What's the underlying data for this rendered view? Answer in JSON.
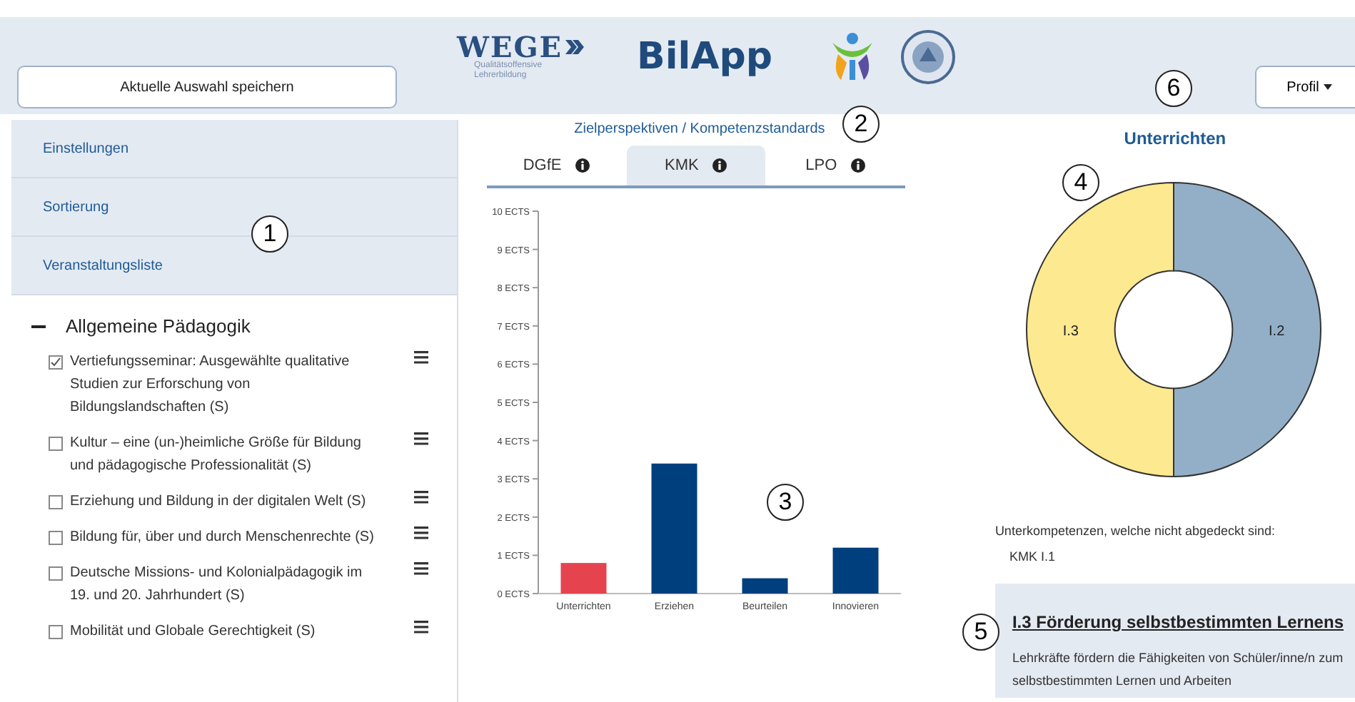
{
  "header": {
    "save_button": "Aktuelle Auswahl speichern",
    "logo_wege": {
      "word": "WEGE",
      "subtitle_1": "Qualitätsoffensive",
      "subtitle_2": "Lehrerbildung"
    },
    "app_title": "BilApp",
    "profile_button": "Profil"
  },
  "sidebar": {
    "panels": [
      "Einstellungen",
      "Sortierung",
      "Veranstaltungsliste"
    ],
    "group": {
      "title": "Allgemeine Pädagogik",
      "expanded": true,
      "courses": [
        {
          "title": "Vertiefungsseminar: Ausgewählte qualitative Studien zur Erforschung von Bildungslandschaften (S)",
          "checked": true
        },
        {
          "title": "Kultur – eine (un-)heimliche Größe für Bildung und pädagogische Professionalität (S)",
          "checked": false
        },
        {
          "title": "Erziehung und Bildung in der digitalen Welt (S)",
          "checked": false
        },
        {
          "title": "Bildung für, über und durch Menschenrechte (S)",
          "checked": false
        },
        {
          "title": "Deutsche Missions- und Kolonialpädagogik im 19. und 20. Jahrhundert (S)",
          "checked": false
        },
        {
          "title": "Mobilität und Globale Gerechtigkeit (S)",
          "checked": false
        }
      ]
    }
  },
  "center": {
    "heading": "Zielperspektiven / Kompetenzstandards",
    "tabs": [
      {
        "label": "DGfE",
        "selected": false
      },
      {
        "label": "KMK",
        "selected": true
      },
      {
        "label": "LPO",
        "selected": false
      }
    ],
    "bars": [
      {
        "color": "#e5444f"
      },
      {
        "color": "#003f7d"
      },
      {
        "color": "#003f7d"
      },
      {
        "color": "#003f7d"
      }
    ],
    "chart_data": {
      "type": "bar",
      "categories": [
        "Unterrichten",
        "Erziehen",
        "Beurteilen",
        "Innovieren"
      ],
      "values": [
        0.8,
        3.4,
        0.4,
        1.2
      ],
      "ylim": [
        0,
        10
      ],
      "yticks": [
        {
          "value": 0,
          "label": "0 ECTS"
        },
        {
          "value": 1,
          "label": "1 ECTS"
        },
        {
          "value": 2,
          "label": "2 ECTS"
        },
        {
          "value": 3,
          "label": "3 ECTS"
        },
        {
          "value": 4,
          "label": "4 ECTS"
        },
        {
          "value": 5,
          "label": "5 ECTS"
        },
        {
          "value": 6,
          "label": "6 ECTS"
        },
        {
          "value": 7,
          "label": "7 ECTS"
        },
        {
          "value": 8,
          "label": "8 ECTS"
        },
        {
          "value": 9,
          "label": "9 ECTS"
        },
        {
          "value": 10,
          "label": "10 ECTS"
        }
      ]
    }
  },
  "right": {
    "title": "Unterrichten",
    "slices": [
      {
        "color": "#fde98f"
      },
      {
        "color": "#93afc8"
      }
    ],
    "chart_data": {
      "type": "donut",
      "categories": [
        "I.3",
        "I.2"
      ],
      "values": [
        50,
        50
      ]
    },
    "missing_label": "Unterkompetenzen, welche nicht abgedeckt sind:",
    "missing": [
      "KMK I.1"
    ],
    "info": {
      "title": "I.3 Förderung selbstbestimmten Lernens",
      "text": "Lehrkräfte fördern die Fähigkeiten von Schüler/inne/n zum selbstbestimmten Lernen und Arbeiten"
    }
  },
  "callouts": [
    "1",
    "2",
    "3",
    "4",
    "5",
    "6"
  ]
}
